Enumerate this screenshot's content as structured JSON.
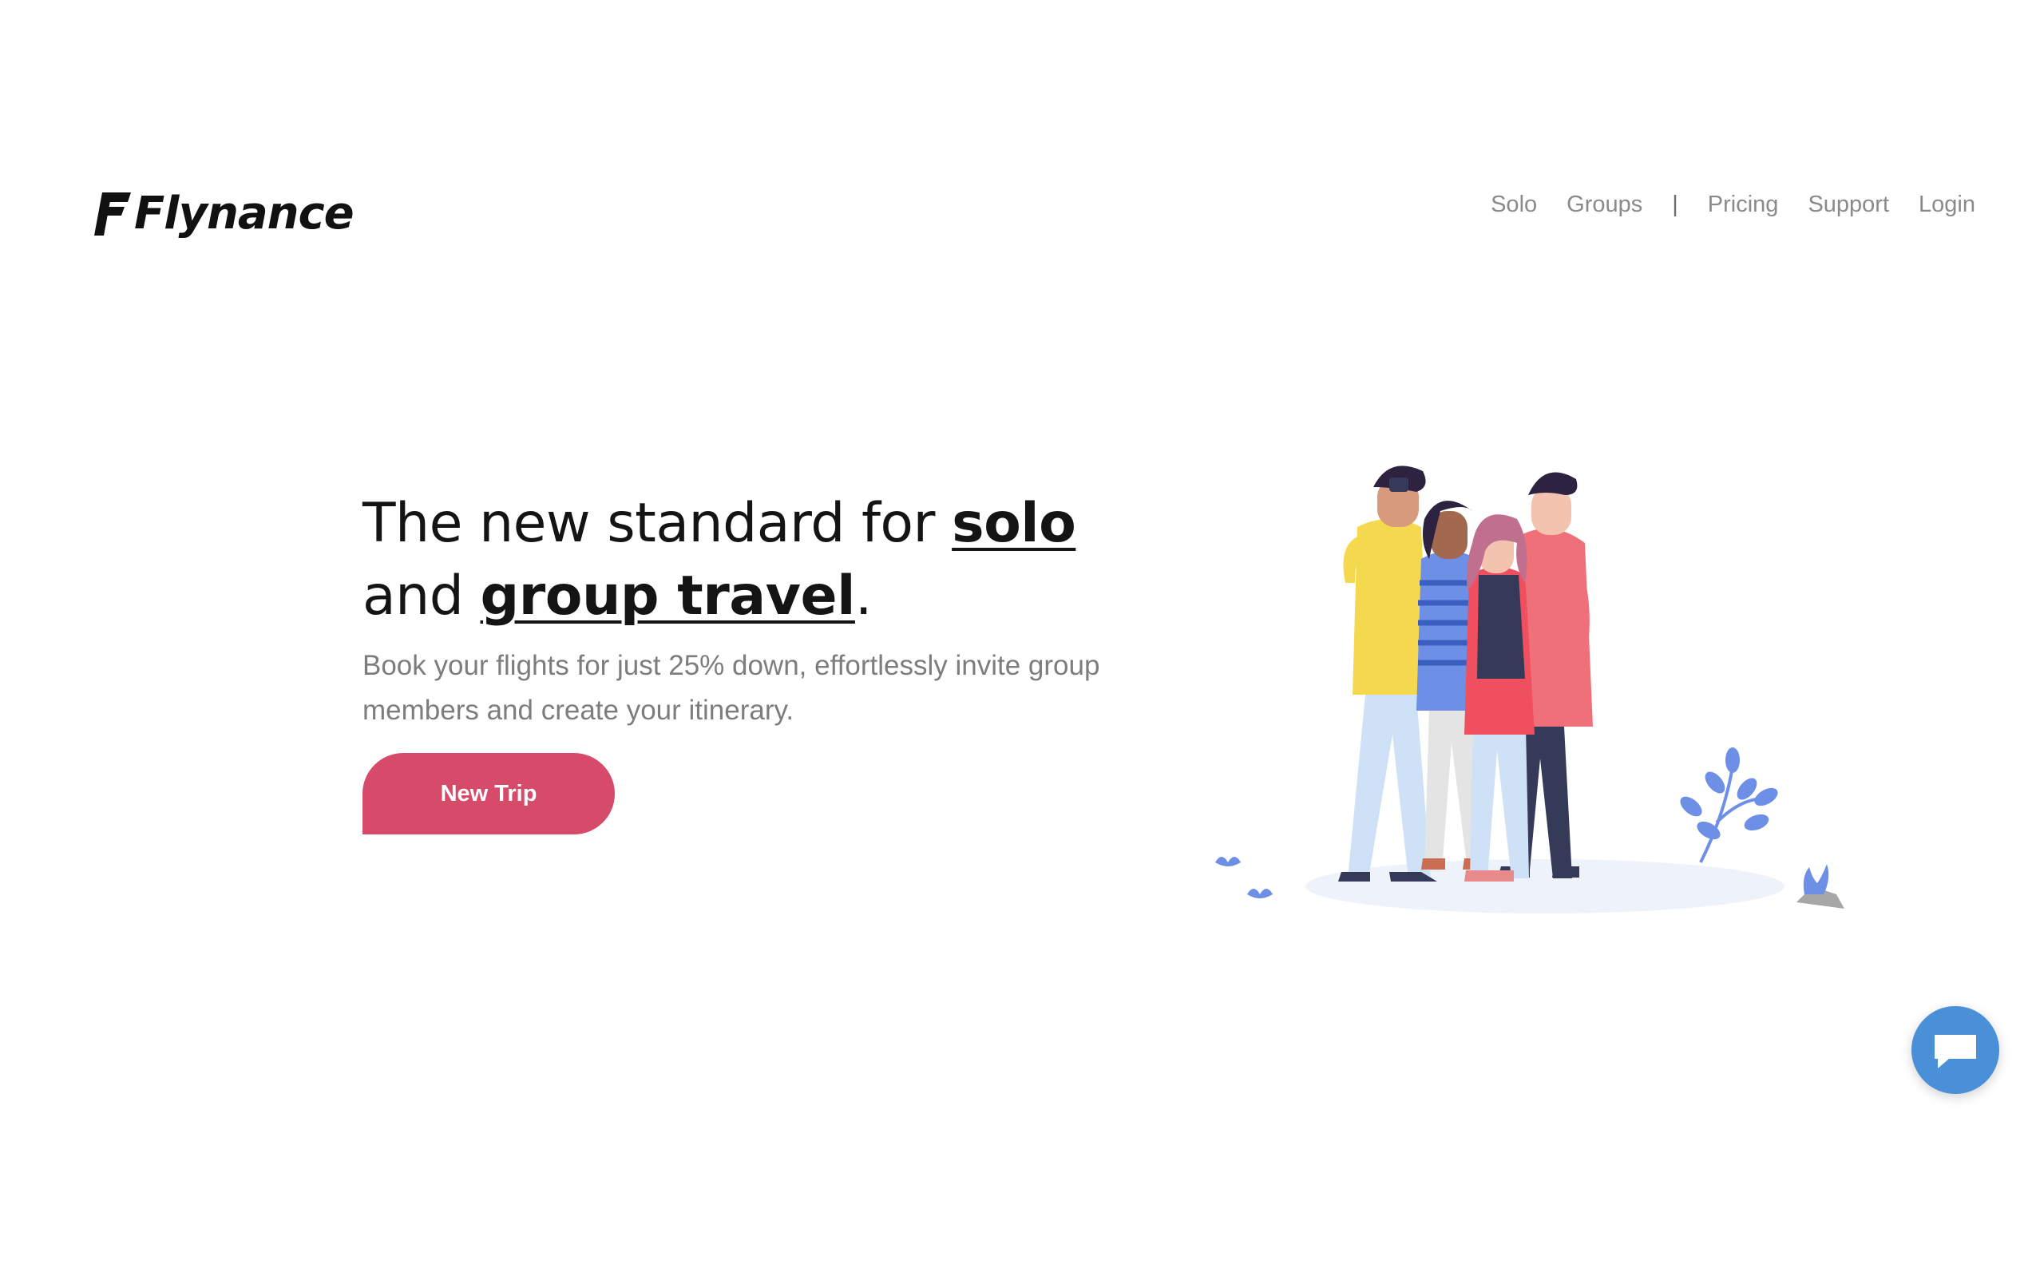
{
  "brand": {
    "name": "Flynance",
    "logo_icon": "flynance-f-logo-icon"
  },
  "nav": {
    "items": [
      {
        "label": "Solo"
      },
      {
        "label": "Groups"
      },
      {
        "label": "Pricing"
      },
      {
        "label": "Support"
      },
      {
        "label": "Login"
      }
    ],
    "separator": "|"
  },
  "hero": {
    "headline_part1": "The new standard for ",
    "headline_em1": "solo",
    "headline_part2": "and ",
    "headline_em2": "group travel",
    "headline_part3": ".",
    "subtext": "Book your flights for just 25% down, effortlessly invite group members and create your itinerary.",
    "cta_label": "New Trip"
  },
  "illustration": {
    "icon": "group-of-friends-selfie-illustration"
  },
  "chat": {
    "icon": "chat-bubble-icon"
  },
  "colors": {
    "accent": "#d64a6a",
    "chat": "#4a90d9",
    "text": "#141414",
    "muted": "#7d7d7d"
  }
}
